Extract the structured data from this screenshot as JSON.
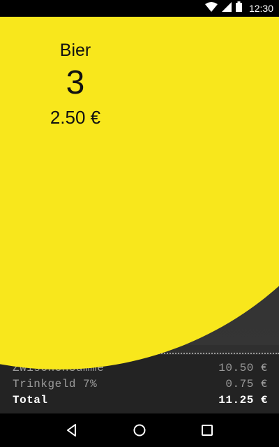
{
  "status_bar": {
    "time": "12:30",
    "icons": [
      "wifi-icon",
      "signal-icon",
      "battery-icon"
    ]
  },
  "item": {
    "name": "Bier",
    "count": "3",
    "price": "2.50 €"
  },
  "receipt": {
    "rows": [
      {
        "label": "Zwischensumme",
        "value": "10.50 €"
      },
      {
        "label": "Trinkgeld 7%",
        "value": "0.75 €"
      },
      {
        "label": "Total",
        "value": "11.25 €"
      }
    ]
  },
  "nav_bar": {
    "icons": [
      "back-icon",
      "home-icon",
      "recents-icon"
    ]
  },
  "colors": {
    "accent": "#f8e71c",
    "background": "#2f2f2f",
    "receipt_bg": "#232323"
  }
}
